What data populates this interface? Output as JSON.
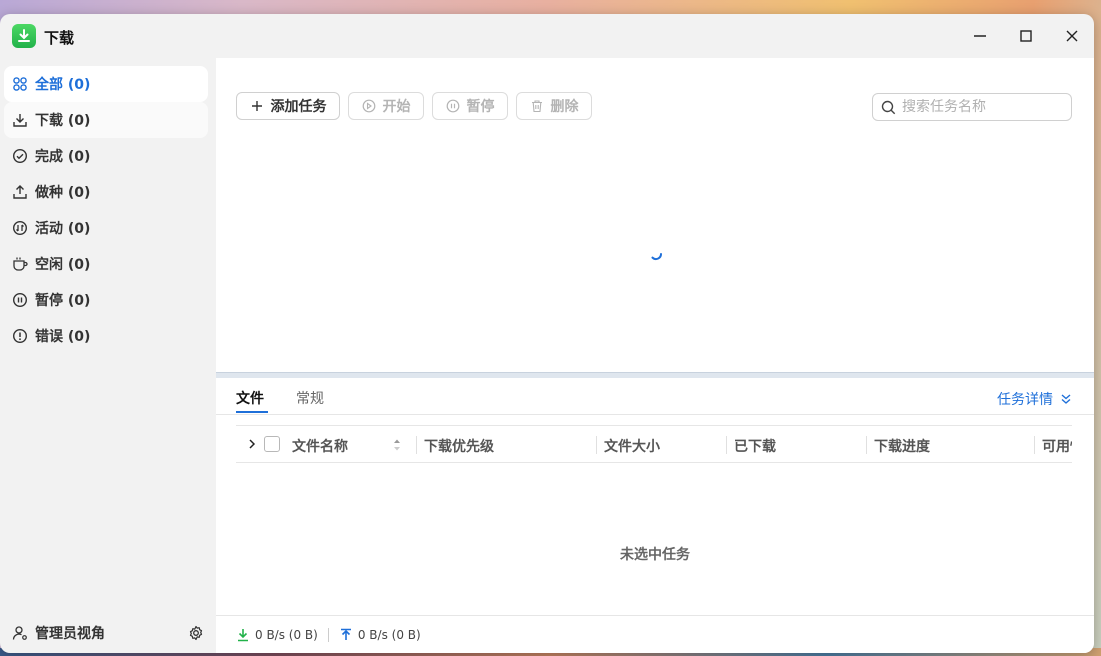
{
  "app": {
    "title": "下载"
  },
  "sidebar": {
    "items": [
      {
        "label": "全部 (0)",
        "icon": "grid-icon"
      },
      {
        "label": "下载 (0)",
        "icon": "download-icon"
      },
      {
        "label": "完成 (0)",
        "icon": "check-circle-icon"
      },
      {
        "label": "做种 (0)",
        "icon": "upload-icon"
      },
      {
        "label": "活动 (0)",
        "icon": "activity-icon"
      },
      {
        "label": "空闲 (0)",
        "icon": "cup-icon"
      },
      {
        "label": "暂停 (0)",
        "icon": "pause-circle-icon"
      },
      {
        "label": "错误 (0)",
        "icon": "alert-circle-icon"
      }
    ],
    "footer_label": "管理员视角"
  },
  "toolbar": {
    "add_label": "添加任务",
    "start_label": "开始",
    "pause_label": "暂停",
    "delete_label": "删除",
    "search_placeholder": "搜索任务名称"
  },
  "detail": {
    "tabs": [
      "文件",
      "常规"
    ],
    "detail_link": "任务详情",
    "columns": [
      "文件名称",
      "下载优先级",
      "文件大小",
      "已下载",
      "下载进度",
      "可用性"
    ],
    "empty_text": "未选中任务"
  },
  "status": {
    "download_speed": "0 B/s (0 B)",
    "upload_speed": "0 B/s (0 B)"
  },
  "colors": {
    "accent": "#1e6fd9",
    "app_green": "#22b24a"
  }
}
